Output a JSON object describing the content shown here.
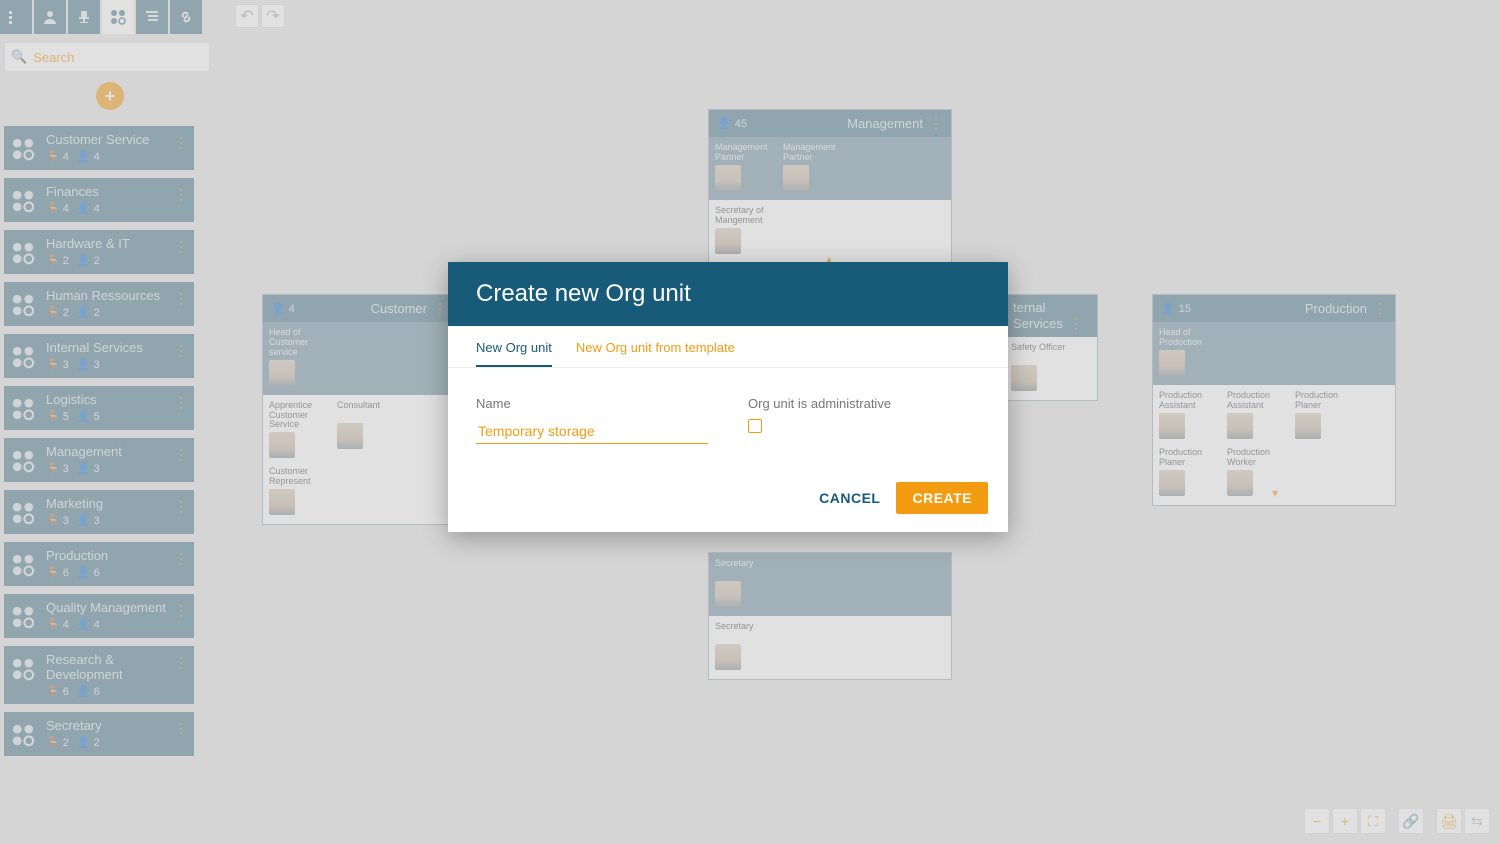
{
  "search": {
    "placeholder": "Search"
  },
  "sidebar": [
    {
      "title": "Customer Service",
      "c1": 4,
      "c2": 4
    },
    {
      "title": "Finances",
      "c1": 4,
      "c2": 4
    },
    {
      "title": "Hardware & IT",
      "c1": 2,
      "c2": 2
    },
    {
      "title": "Human Ressources",
      "c1": 2,
      "c2": 2
    },
    {
      "title": "Internal Services",
      "c1": 3,
      "c2": 3
    },
    {
      "title": "Logistics",
      "c1": 5,
      "c2": 5
    },
    {
      "title": "Management",
      "c1": 3,
      "c2": 3
    },
    {
      "title": "Marketing",
      "c1": 3,
      "c2": 3
    },
    {
      "title": "Production",
      "c1": 6,
      "c2": 6
    },
    {
      "title": "Quality Management",
      "c1": 4,
      "c2": 4
    },
    {
      "title": "Research & Development",
      "c1": 6,
      "c2": 6
    },
    {
      "title": "Secretary",
      "c1": 2,
      "c2": 2
    }
  ],
  "cards": {
    "management": {
      "title": "Management",
      "count": 45,
      "rolesTop": [
        "Management Partner",
        "Management Partner"
      ],
      "rolesBot": [
        "Secretary of Mangement"
      ]
    },
    "customer": {
      "title": "Customer",
      "count": 4,
      "rolesTop": [
        "Head of Customer service"
      ],
      "rolesBot": [
        "Apprentice Customer Service",
        "Consultant",
        "Customer Represent"
      ]
    },
    "internal": {
      "title": "ternal Services",
      "rolesTop": [
        "Safety Officer"
      ]
    },
    "production": {
      "title": "Production",
      "count": 15,
      "rolesTop": [
        "Head of Production"
      ],
      "rolesBot": [
        "Production Assistant",
        "Production Assistant",
        "Production Planer",
        "Production Planer",
        "Production Worker"
      ]
    },
    "secretary": {
      "rolesTop": [
        "Secretary"
      ],
      "rolesBot": [
        "Secretary"
      ]
    }
  },
  "modal": {
    "title": "Create new Org unit",
    "tab1": "New Org unit",
    "tab2": "New Org unit from template",
    "nameLabel": "Name",
    "nameValue": "Temporary storage",
    "adminLabel": "Org unit is administrative",
    "cancel": "CANCEL",
    "create": "CREATE"
  }
}
